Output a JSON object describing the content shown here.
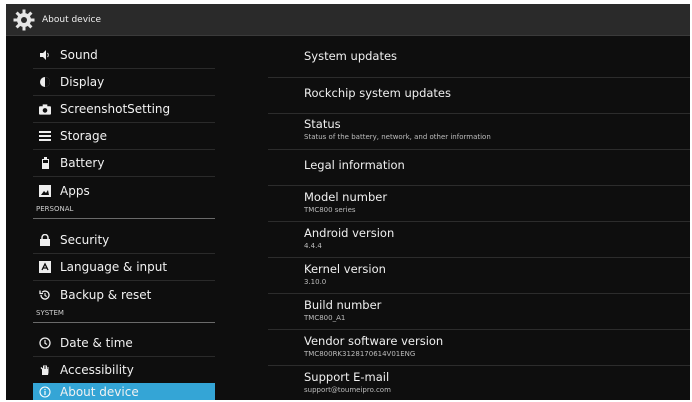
{
  "header": {
    "title": "About device",
    "icon": "gear-icon"
  },
  "sidebar": {
    "items": [
      {
        "label": "Sound",
        "icon": "volume-icon"
      },
      {
        "label": "Display",
        "icon": "brightness-icon"
      },
      {
        "label": "ScreenshotSetting",
        "icon": "camera-icon"
      },
      {
        "label": "Storage",
        "icon": "storage-icon"
      },
      {
        "label": "Battery",
        "icon": "battery-icon"
      },
      {
        "label": "Apps",
        "icon": "apps-icon"
      },
      {
        "label": "Security",
        "icon": "lock-icon"
      },
      {
        "label": "Language & input",
        "icon": "keyboard-icon"
      },
      {
        "label": "Backup & reset",
        "icon": "backup-icon"
      },
      {
        "label": "Date & time",
        "icon": "clock-icon"
      },
      {
        "label": "Accessibility",
        "icon": "hand-icon"
      },
      {
        "label": "About device",
        "icon": "info-icon"
      }
    ],
    "sections": {
      "personal": "PERSONAL",
      "system": "SYSTEM"
    },
    "active_color": "#34a5d6"
  },
  "main": {
    "rows": [
      {
        "title": "System updates",
        "subtitle": ""
      },
      {
        "title": "Rockchip system updates",
        "subtitle": ""
      },
      {
        "title": "Status",
        "subtitle": "Status of the battery, network, and other information"
      },
      {
        "title": "Legal information",
        "subtitle": ""
      },
      {
        "title": "Model number",
        "subtitle": "TMC800 series"
      },
      {
        "title": "Android version",
        "subtitle": "4.4.4"
      },
      {
        "title": "Kernel version",
        "subtitle": "3.10.0"
      },
      {
        "title": "Build number",
        "subtitle": "TMC800_A1"
      },
      {
        "title": "Vendor software version",
        "subtitle": "TMC800RK3128170614V01ENG"
      },
      {
        "title": "Support E-mail",
        "subtitle": "support@toumeipro.com"
      }
    ]
  }
}
